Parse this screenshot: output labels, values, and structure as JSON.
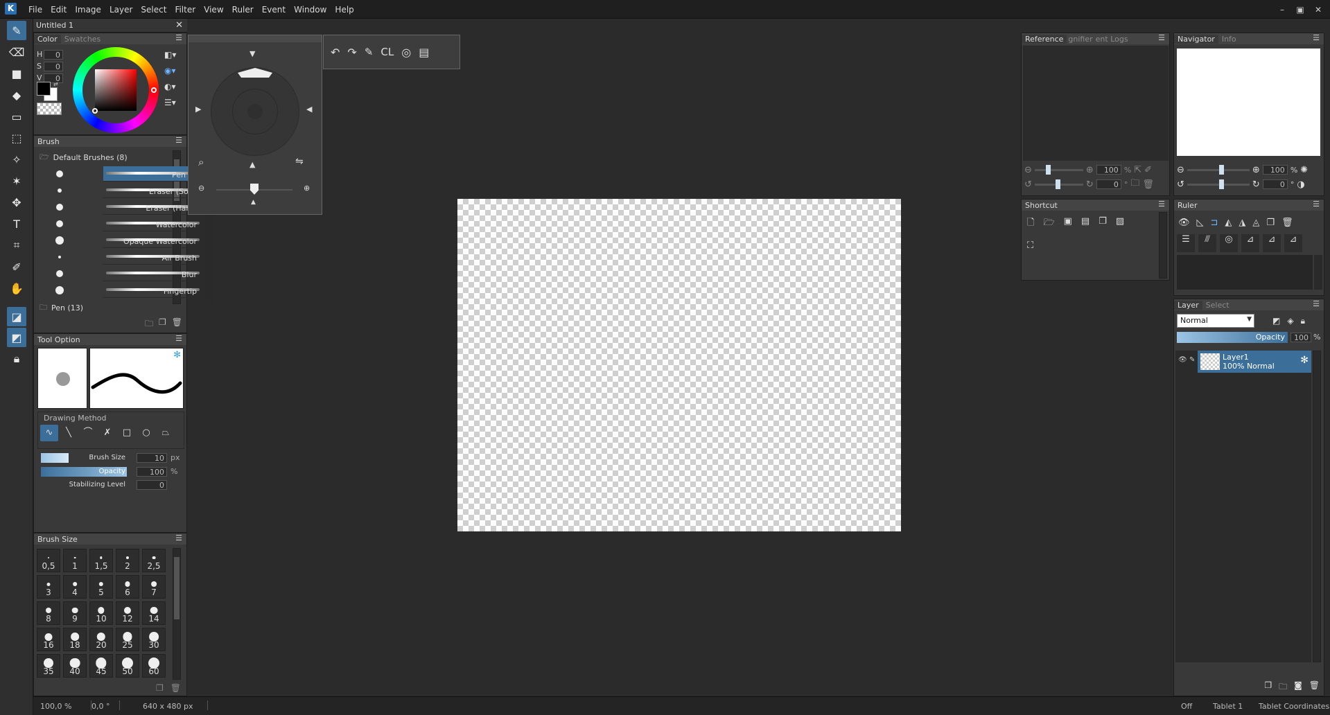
{
  "menubar": {
    "logo": "K",
    "items": [
      "File",
      "Edit",
      "Image",
      "Layer",
      "Select",
      "Filter",
      "View",
      "Ruler",
      "Event",
      "Window",
      "Help"
    ],
    "controls": [
      "–",
      "▣",
      "✕"
    ]
  },
  "document_tab": {
    "title": "Untitled 1",
    "close": "✕"
  },
  "color_panel": {
    "tabs": [
      "Color",
      "Swatches"
    ],
    "hsv": [
      {
        "label": "H",
        "value": "0"
      },
      {
        "label": "S",
        "value": "0"
      },
      {
        "label": "V",
        "value": "0"
      }
    ],
    "primary_color": "#000000",
    "secondary_color": "#ffffff"
  },
  "brush_panel": {
    "title": "Brush",
    "group_open": "Default Brushes (8)",
    "brushes": [
      "Pen",
      "Eraser (Soft)",
      "Eraser (Hard)",
      "Watercolor",
      "Opaque Watercolor",
      "Air Brush",
      "Blur",
      "Fingertip"
    ],
    "group_closed": "Pen (13)"
  },
  "tool_option": {
    "title": "Tool Option",
    "drawing_method_label": "Drawing Method",
    "brush_size_label": "Brush Size",
    "brush_size_value": "10",
    "brush_size_unit": "px",
    "opacity_label": "Opacity",
    "opacity_value": "100",
    "opacity_unit": "%",
    "stabilizing_label": "Stabilizing Level",
    "stabilizing_value": "0"
  },
  "brush_size_panel": {
    "title": "Brush Size",
    "sizes": [
      "0,5",
      "1",
      "1,5",
      "2",
      "2,5",
      "3",
      "4",
      "5",
      "6",
      "7",
      "8",
      "9",
      "10",
      "12",
      "14",
      "16",
      "18",
      "20",
      "25",
      "30",
      "35",
      "40",
      "45",
      "50",
      "60"
    ]
  },
  "command_bar": {
    "cl_label": "CL"
  },
  "reference_panel": {
    "tabs": [
      "Reference",
      "gnifier",
      "ent Logs"
    ],
    "zoom_value": "100",
    "zoom_unit": "%",
    "rotate_value": "0",
    "rotate_unit": "°"
  },
  "navigator_panel": {
    "tabs": [
      "Navigator",
      "Info"
    ],
    "zoom_value": "100",
    "zoom_unit": "%",
    "rotate_value": "0",
    "rotate_unit": "°"
  },
  "shortcut_panel": {
    "title": "Shortcut"
  },
  "ruler_panel": {
    "title": "Ruler"
  },
  "layer_panel": {
    "tabs": [
      "Layer",
      "Select"
    ],
    "blend_mode": "Normal",
    "opacity_label": "Opacity",
    "opacity_value": "100",
    "opacity_unit": "%",
    "layers": [
      {
        "name": "Layer1",
        "info": "100% Normal"
      }
    ]
  },
  "statusbar": {
    "zoom": "100,0 %",
    "angle": "0,0 °",
    "size": "640 x 480 px",
    "right": [
      "Off",
      "Tablet 1",
      "Tablet Coordinates"
    ]
  },
  "colors": {
    "accent": "#3b6f9a",
    "panel": "#393939",
    "background": "#2b2b2b"
  }
}
